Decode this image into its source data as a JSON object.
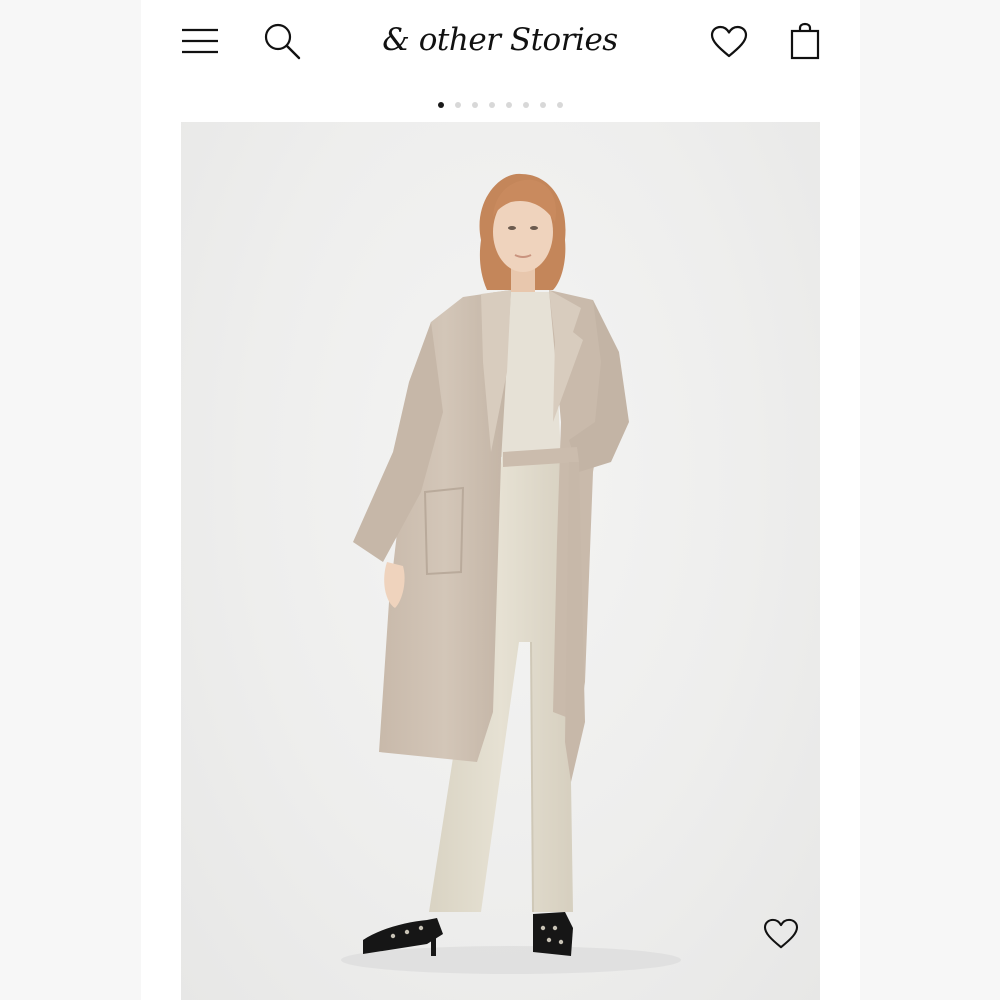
{
  "header": {
    "brand_name": "& other Stories",
    "icons": {
      "menu": "hamburger-menu-icon",
      "search": "search-icon",
      "wishlist": "heart-icon",
      "bag": "shopping-bag-icon"
    }
  },
  "carousel": {
    "total_images": 8,
    "active_index": 1
  },
  "product_image": {
    "wishlist_icon": "heart-icon",
    "colors": {
      "coat": "#cdbfb1",
      "trousers": "#e1dccd",
      "top": "#e6e1d6",
      "hair": "#c98a5e",
      "shoes": "#161616",
      "background": "#eeeeed"
    }
  }
}
